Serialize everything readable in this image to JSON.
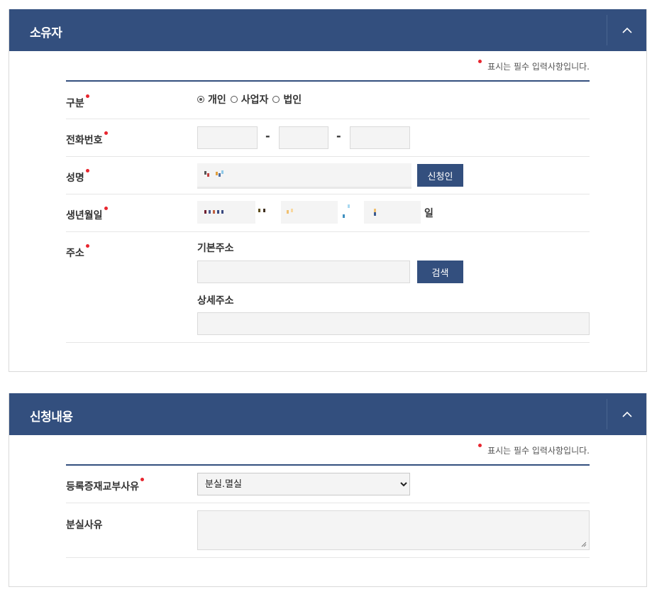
{
  "owner": {
    "title": "소유자",
    "required_note": "표시는 필수 입력사항입니다.",
    "category": {
      "label": "구분",
      "options": [
        "개인",
        "사업자",
        "법인"
      ],
      "selected": "개인"
    },
    "phone": {
      "label": "전화번호",
      "separator": "-"
    },
    "name": {
      "label": "성명",
      "button": "신청인"
    },
    "birth": {
      "label": "생년월일",
      "day_suffix": "일"
    },
    "address": {
      "label": "주소",
      "basic_label": "기본주소",
      "search_button": "검색",
      "detail_label": "상세주소"
    }
  },
  "application": {
    "title": "신청내용",
    "required_note": "표시는 필수 입력사항입니다.",
    "reason": {
      "label": "등록증재교부사유",
      "selected": "분실.멸실"
    },
    "loss_reason": {
      "label": "분실사유"
    }
  },
  "colors": {
    "header": "#334f7e",
    "required_dot": "#e8262f"
  },
  "icons": {
    "collapse": "chevron-up-icon"
  }
}
